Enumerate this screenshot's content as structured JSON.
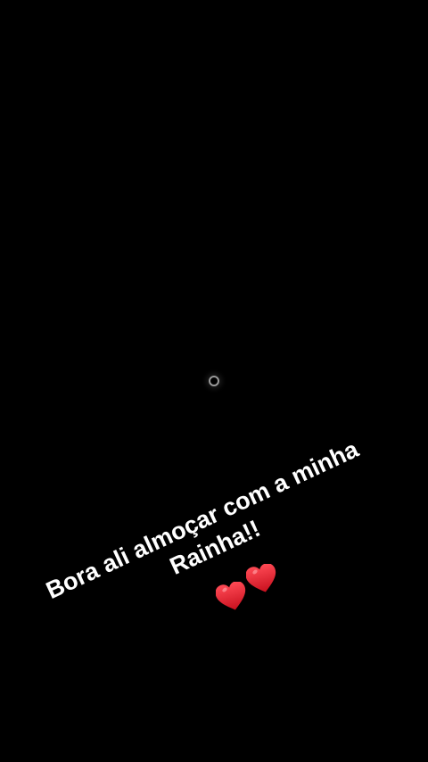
{
  "loader": {
    "icon": "loading-spinner-icon"
  },
  "caption": {
    "line1": "Bora ali almoçar com a minha",
    "line2": "Rainha!!"
  },
  "hearts": {
    "icon": "red-heart-icon",
    "count": 2,
    "color": "#e0202e"
  },
  "colors": {
    "background": "#000000",
    "text": "#ffffff"
  }
}
